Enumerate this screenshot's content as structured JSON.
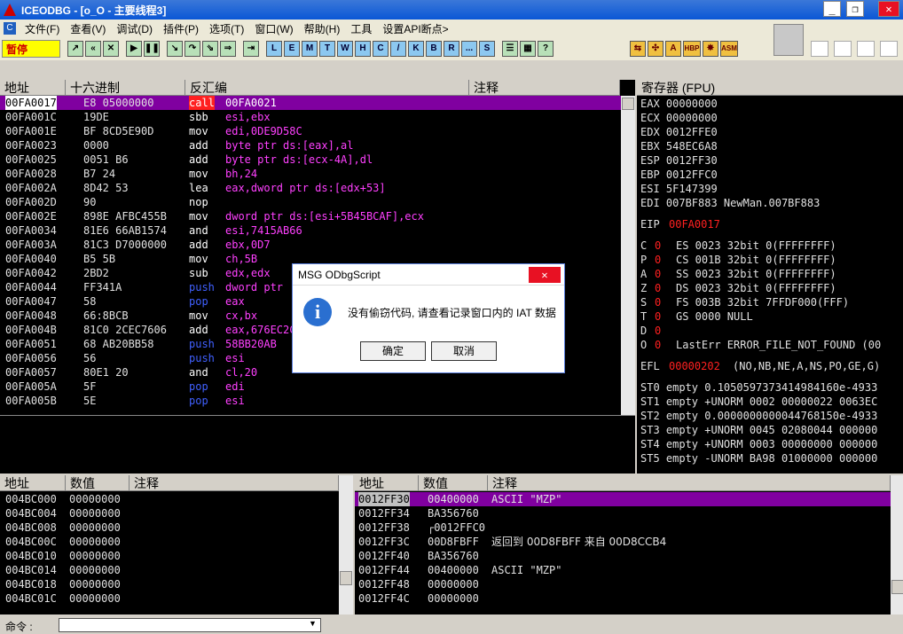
{
  "title": "ICEODBG - [o_O - 主要线程3]",
  "window_buttons": [
    "_",
    "❐",
    "✕"
  ],
  "menu": [
    "文件(F)",
    "查看(V)",
    "调试(D)",
    "插件(P)",
    "选项(T)",
    "窗口(W)",
    "帮助(H)",
    "工具",
    "设置API断点>"
  ],
  "status": "暂停",
  "toolbar_letters": [
    "L",
    "E",
    "M",
    "T",
    "W",
    "H",
    "C",
    "/",
    "K",
    "B",
    "R",
    "...",
    "S"
  ],
  "toolbar_right": [
    "HBP",
    "ASM"
  ],
  "disasm": {
    "headers": [
      "地址",
      "十六进制",
      "反汇编",
      "注释"
    ],
    "rows": [
      {
        "addr": "00FA0017",
        "hex": "E8 05000000",
        "m": "call",
        "op": "00FA0021",
        "mc": "c"
      },
      {
        "addr": "00FA001C",
        "hex": "19DE",
        "m": "sbb",
        "op": "esi,ebx",
        "mc": "a"
      },
      {
        "addr": "00FA001E",
        "hex": "BF 8CD5E90D",
        "m": "mov",
        "op": "edi,0DE9D58C",
        "mc": "a"
      },
      {
        "addr": "00FA0023",
        "hex": "0000",
        "m": "add",
        "op": "byte ptr ds:[eax],al",
        "mc": "a"
      },
      {
        "addr": "00FA0025",
        "hex": "0051 B6",
        "m": "add",
        "op": "byte ptr ds:[ecx-4A],dl",
        "mc": "a"
      },
      {
        "addr": "00FA0028",
        "hex": "B7 24",
        "m": "mov",
        "op": "bh,24",
        "mc": "a"
      },
      {
        "addr": "00FA002A",
        "hex": "8D42 53",
        "m": "lea",
        "op": "eax,dword ptr ds:[edx+53]",
        "mc": "a"
      },
      {
        "addr": "00FA002D",
        "hex": "90",
        "m": "nop",
        "op": "",
        "mc": "a"
      },
      {
        "addr": "00FA002E",
        "hex": "898E AFBC455B",
        "m": "mov",
        "op": "dword ptr ds:[esi+5B45BCAF],ecx",
        "mc": "a"
      },
      {
        "addr": "00FA0034",
        "hex": "81E6 66AB1574",
        "m": "and",
        "op": "esi,7415AB66",
        "mc": "a"
      },
      {
        "addr": "00FA003A",
        "hex": "81C3 D7000000",
        "m": "add",
        "op": "ebx,0D7",
        "mc": "a"
      },
      {
        "addr": "00FA0040",
        "hex": "B5 5B",
        "m": "mov",
        "op": "ch,5B",
        "mc": "a"
      },
      {
        "addr": "00FA0042",
        "hex": "2BD2",
        "m": "sub",
        "op": "edx,edx",
        "mc": "a"
      },
      {
        "addr": "00FA0044",
        "hex": "FF341A",
        "m": "push",
        "op": "dword ptr",
        "mc": "p"
      },
      {
        "addr": "00FA0047",
        "hex": "58",
        "m": "pop",
        "op": "eax",
        "mc": "p"
      },
      {
        "addr": "00FA0048",
        "hex": "66:8BCB",
        "m": "mov",
        "op": "cx,bx",
        "mc": "a"
      },
      {
        "addr": "00FA004B",
        "hex": "81C0 2CEC7606",
        "m": "add",
        "op": "eax,676EC2C",
        "mc": "a"
      },
      {
        "addr": "00FA0051",
        "hex": "68 AB20BB58",
        "m": "push",
        "op": "58BB20AB",
        "mc": "p"
      },
      {
        "addr": "00FA0056",
        "hex": "56",
        "m": "push",
        "op": "esi",
        "mc": "p"
      },
      {
        "addr": "00FA0057",
        "hex": "80E1 20",
        "m": "and",
        "op": "cl,20",
        "mc": "a"
      },
      {
        "addr": "00FA005A",
        "hex": "5F",
        "m": "pop",
        "op": "edi",
        "mc": "p"
      },
      {
        "addr": "00FA005B",
        "hex": "5E",
        "m": "pop",
        "op": "esi",
        "mc": "p"
      }
    ]
  },
  "registers": {
    "title": "寄存器 (FPU)",
    "gp": [
      "EAX 00000000",
      "ECX 00000000",
      "EDX 0012FFE0",
      "EBX 548EC6A8",
      "ESP 0012FF30",
      "EBP 0012FFC0",
      "ESI 5F147399",
      "EDI 007BF883 NewMan.007BF883"
    ],
    "eip_label": "EIP",
    "eip": "00FA0017",
    "flags": [
      {
        "f": "C",
        "v": "0",
        "seg": "ES 0023 32bit 0(FFFFFFFF)"
      },
      {
        "f": "P",
        "v": "0",
        "seg": "CS 001B 32bit 0(FFFFFFFF)"
      },
      {
        "f": "A",
        "v": "0",
        "seg": "SS 0023 32bit 0(FFFFFFFF)"
      },
      {
        "f": "Z",
        "v": "0",
        "seg": "DS 0023 32bit 0(FFFFFFFF)"
      },
      {
        "f": "S",
        "v": "0",
        "seg": "FS 003B 32bit 7FFDF000(FFF)"
      },
      {
        "f": "T",
        "v": "0",
        "seg": "GS 0000 NULL"
      },
      {
        "f": "D",
        "v": "0",
        "seg": ""
      },
      {
        "f": "O",
        "v": "0",
        "seg": "LastErr ERROR_FILE_NOT_FOUND (00"
      }
    ],
    "efl_label": "EFL",
    "efl": "00000202",
    "efl_desc": "(NO,NB,NE,A,NS,PO,GE,G)",
    "fpu": [
      "ST0 empty 0.1050597373414984160e-4933",
      "ST1 empty +UNORM 0002 00000022 0063EC",
      "ST2 empty 0.0000000000044768150e-4933",
      "ST3 empty +UNORM 0045 02080044 000000",
      "ST4 empty +UNORM 0003 00000000 000000",
      "ST5 empty -UNORM BA98 01000000 000000"
    ]
  },
  "dump": {
    "headers": [
      "地址",
      "数值",
      "注释"
    ],
    "rows": [
      [
        "004BC000",
        "00000000"
      ],
      [
        "004BC004",
        "00000000"
      ],
      [
        "004BC008",
        "00000000"
      ],
      [
        "004BC00C",
        "00000000"
      ],
      [
        "004BC010",
        "00000000"
      ],
      [
        "004BC014",
        "00000000"
      ],
      [
        "004BC018",
        "00000000"
      ],
      [
        "004BC01C",
        "00000000"
      ]
    ]
  },
  "stack": {
    "headers": [
      "地址",
      "数值",
      "注释"
    ],
    "rows": [
      [
        "0012FF30",
        "00400000",
        "ASCII \"MZP\""
      ],
      [
        "0012FF34",
        "BA356760",
        ""
      ],
      [
        "0012FF38",
        "┌0012FFC0",
        ""
      ],
      [
        "0012FF3C",
        "00D8FBFF",
        "返回到 00D8FBFF 来自 00D8CCB4"
      ],
      [
        "0012FF40",
        "BA356760",
        ""
      ],
      [
        "0012FF44",
        "00400000",
        "ASCII \"MZP\""
      ],
      [
        "0012FF48",
        "00000000",
        ""
      ],
      [
        "0012FF4C",
        "00000000",
        ""
      ]
    ]
  },
  "dialog": {
    "title": "MSG ODbgScript",
    "message": "没有偷窃代码, 请查看记录窗口内的 IAT 数据",
    "ok": "确定",
    "cancel": "取消",
    "close": "✕"
  },
  "command": {
    "label": "命令 :",
    "value": ""
  }
}
